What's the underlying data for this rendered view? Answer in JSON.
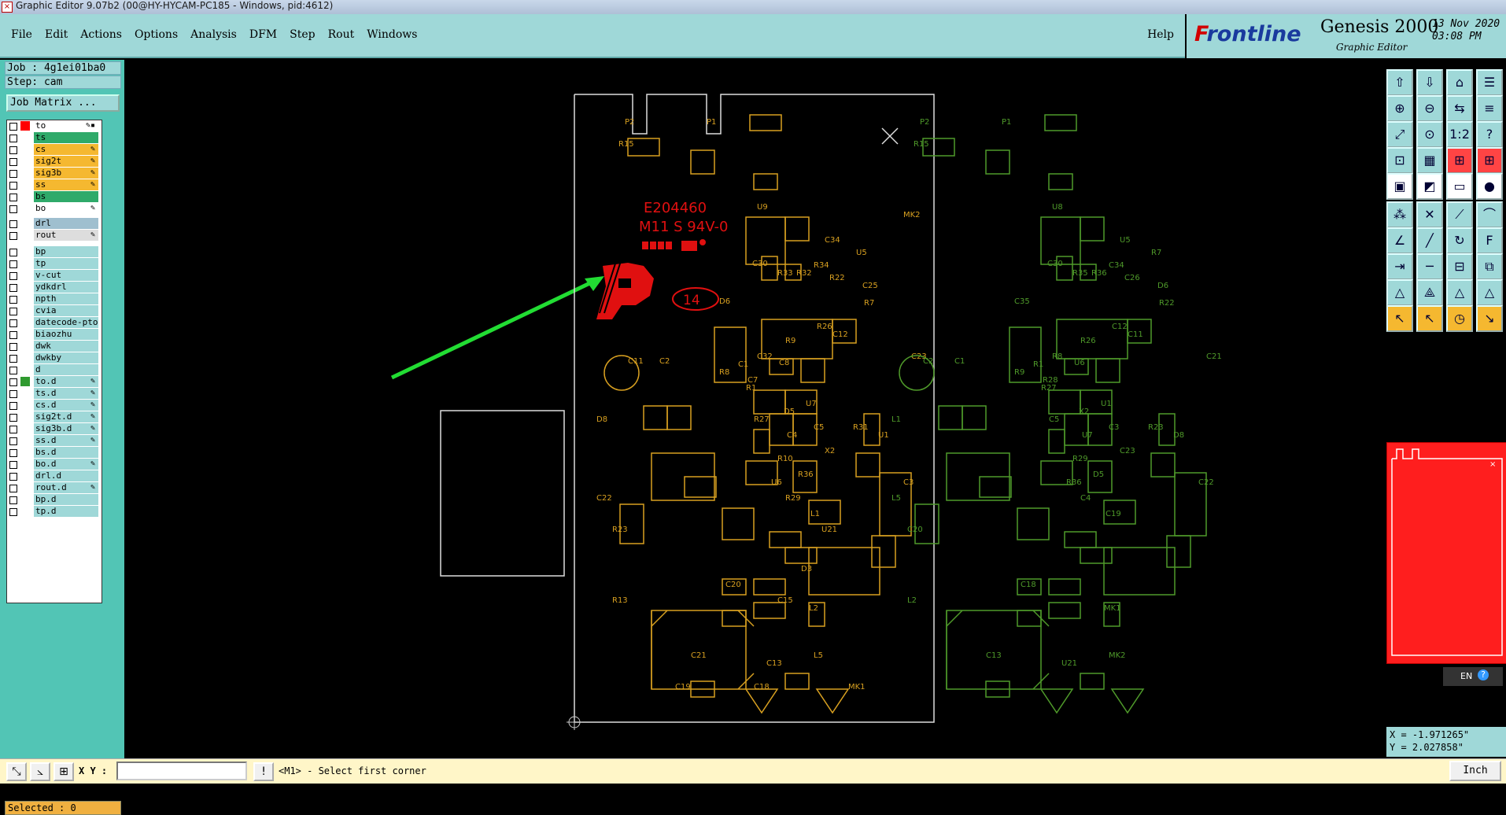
{
  "window": {
    "title": "Graphic Editor 9.07b2 (00@HY-HYCAM-PC185 - Windows, pid:4612)"
  },
  "menu": {
    "items": [
      "File",
      "Edit",
      "Actions",
      "Options",
      "Analysis",
      "DFM",
      "Step",
      "Rout",
      "Windows"
    ],
    "help": "Help"
  },
  "brand": {
    "logo_f": "F",
    "logo_rest": "rontline",
    "product": "Genesis 2000",
    "subtitle": "Graphic Editor",
    "date": "13 Nov 2020",
    "time": "03:08 PM"
  },
  "job": {
    "job_label": "Job : 4g1ei01ba0",
    "step_label": "Step: cam",
    "matrix_button": "Job Matrix ..."
  },
  "layers": [
    {
      "name": "to",
      "color": "#ffffff",
      "sw": "#ff0000",
      "edit": "✎▪"
    },
    {
      "name": "ts",
      "color": "#2faa6a",
      "sw": "",
      "edit": ""
    },
    {
      "name": "cs",
      "color": "#f5b830",
      "sw": "",
      "edit": "✎"
    },
    {
      "name": "sig2t",
      "color": "#f5b830",
      "sw": "",
      "edit": "✎"
    },
    {
      "name": "sig3b",
      "color": "#f5b830",
      "sw": "",
      "edit": "✎"
    },
    {
      "name": "ss",
      "color": "#f5b830",
      "sw": "",
      "edit": "✎"
    },
    {
      "name": "bs",
      "color": "#2faa6a",
      "sw": "",
      "edit": ""
    },
    {
      "name": "bo",
      "color": "#ffffff",
      "sw": "",
      "edit": "✎"
    },
    {
      "name": "drl",
      "color": "#9fbfcf",
      "sw": "",
      "edit": ""
    },
    {
      "name": "rout",
      "color": "#dddddd",
      "sw": "",
      "edit": "✎"
    },
    {
      "name": "bp",
      "color": "#9fd8d8",
      "sw": "",
      "edit": ""
    },
    {
      "name": "tp",
      "color": "#9fd8d8",
      "sw": "",
      "edit": ""
    },
    {
      "name": "v-cut",
      "color": "#9fd8d8",
      "sw": "",
      "edit": ""
    },
    {
      "name": "ydkdrl",
      "color": "#9fd8d8",
      "sw": "",
      "edit": ""
    },
    {
      "name": "npth",
      "color": "#9fd8d8",
      "sw": "",
      "edit": ""
    },
    {
      "name": "cvia",
      "color": "#9fd8d8",
      "sw": "",
      "edit": ""
    },
    {
      "name": "datecode-pto",
      "color": "#9fd8d8",
      "sw": "",
      "edit": ""
    },
    {
      "name": "biaozhu",
      "color": "#9fd8d8",
      "sw": "",
      "edit": ""
    },
    {
      "name": "dwk",
      "color": "#9fd8d8",
      "sw": "",
      "edit": ""
    },
    {
      "name": "dwkby",
      "color": "#9fd8d8",
      "sw": "",
      "edit": ""
    },
    {
      "name": "d",
      "color": "#9fd8d8",
      "sw": "",
      "edit": ""
    },
    {
      "name": "to.d",
      "color": "#9fd8d8",
      "sw": "#2f9a2f",
      "edit": "✎"
    },
    {
      "name": "ts.d",
      "color": "#9fd8d8",
      "sw": "",
      "edit": "✎"
    },
    {
      "name": "cs.d",
      "color": "#9fd8d8",
      "sw": "",
      "edit": "✎"
    },
    {
      "name": "sig2t.d",
      "color": "#9fd8d8",
      "sw": "",
      "edit": "✎"
    },
    {
      "name": "sig3b.d",
      "color": "#9fd8d8",
      "sw": "",
      "edit": "✎"
    },
    {
      "name": "ss.d",
      "color": "#9fd8d8",
      "sw": "",
      "edit": "✎"
    },
    {
      "name": "bs.d",
      "color": "#9fd8d8",
      "sw": "",
      "edit": ""
    },
    {
      "name": "bo.d",
      "color": "#9fd8d8",
      "sw": "",
      "edit": "✎"
    },
    {
      "name": "drl.d",
      "color": "#9fd8d8",
      "sw": "",
      "edit": ""
    },
    {
      "name": "rout.d",
      "color": "#9fd8d8",
      "sw": "",
      "edit": "✎"
    },
    {
      "name": "bp.d",
      "color": "#9fd8d8",
      "sw": "",
      "edit": ""
    },
    {
      "name": "tp.d",
      "color": "#9fd8d8",
      "sw": "",
      "edit": ""
    }
  ],
  "selected": "Selected : 0",
  "board": {
    "ul_number": "E204460",
    "rating": "M11 S 94V-0",
    "date_code": "14",
    "refdes_orange": [
      "R15",
      "P2",
      "P1",
      "U9",
      "C30",
      "R33",
      "R32",
      "R34",
      "C34",
      "U5",
      "R7",
      "R22",
      "C25",
      "D6",
      "C32",
      "R8",
      "R9",
      "R26",
      "C12",
      "C11",
      "C2",
      "C1",
      "R1",
      "R27",
      "C7",
      "C8",
      "R10",
      "U6",
      "R29",
      "R36",
      "C4",
      "D5",
      "U7",
      "C5",
      "X2",
      "R31",
      "U1",
      "C3",
      "C23",
      "R23",
      "D8",
      "R13",
      "C22",
      "C21",
      "C20",
      "L1",
      "L2",
      "L5",
      "C13",
      "C15",
      "C18",
      "C19",
      "MK1",
      "MK2",
      "U21",
      "D3"
    ],
    "refdes_green": [
      "R15",
      "P2",
      "P1",
      "U8",
      "C30",
      "R35",
      "R36",
      "C34",
      "U5",
      "R7",
      "R22",
      "C26",
      "D6",
      "C35",
      "R8",
      "R9",
      "R26",
      "C12",
      "C11",
      "C2",
      "C1",
      "R1",
      "R27",
      "C5",
      "R28",
      "U6",
      "R29",
      "R36",
      "C4",
      "D5",
      "U7",
      "X2",
      "U1",
      "C3",
      "C23",
      "R23",
      "D8",
      "C22",
      "C21",
      "C20",
      "L1",
      "L2",
      "L5",
      "C13",
      "C18",
      "C19",
      "MK1",
      "MK2",
      "U21"
    ]
  },
  "toolbar_icons": [
    "layer-up-icon",
    "layer-down-icon",
    "home-icon",
    "list-icon",
    "zoom-in-icon",
    "zoom-out-icon",
    "flip-icon",
    "menu-icon",
    "fit-icon",
    "center-icon",
    "scale-icon",
    "help-icon",
    "lock-icon",
    "grid-icon",
    "snap-icon",
    "snap2-icon",
    "select-icon",
    "cut-icon",
    "ruler-icon",
    "record-icon",
    "node-icon",
    "cross-icon",
    "split-icon",
    "arc-icon",
    "angle-icon",
    "line-icon",
    "rotate-icon",
    "text-icon",
    "move-icon",
    "shift-icon",
    "align-icon",
    "pad-icon",
    "mirror-icon",
    "arrow-icon",
    "copy-icon",
    "delete-icon",
    "pointer-icon",
    "pointer2-icon",
    "clock-icon",
    "measure-icon"
  ],
  "coords": {
    "x": "X = -1.971265\"",
    "y": "Y = 2.027858\""
  },
  "lang": "EN",
  "status": {
    "xy_label": "X Y :",
    "xy_value": "",
    "prompt": "<M1> - Select first corner",
    "units": "Inch"
  }
}
